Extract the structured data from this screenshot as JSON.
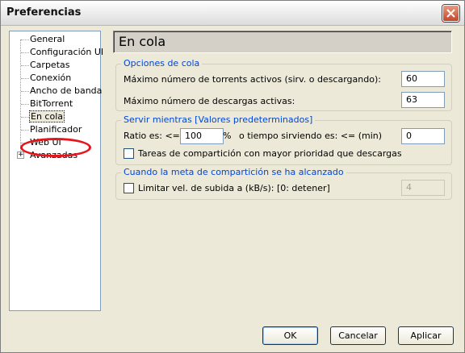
{
  "window": {
    "title": "Preferencias"
  },
  "nav": {
    "items": [
      "General",
      "Configuración UI",
      "Carpetas",
      "Conexión",
      "Ancho de banda",
      "BitTorrent",
      "En cola",
      "Planificador",
      "Web UI",
      "Avanzadas"
    ],
    "selected": "En cola",
    "expand_symbol": "+"
  },
  "page": {
    "title": "En cola"
  },
  "queue": {
    "group_label": "Opciones de cola",
    "max_active_label": "Máximo número de torrents activos (sirv. o descargando):",
    "max_active_value": "60",
    "max_downloads_label": "Máximo número de descargas activas:",
    "max_downloads_value": "63"
  },
  "seeding": {
    "group_label": "Servir mientras [Valores predeterminados]",
    "ratio_label": "Ratio es: <=",
    "ratio_value": "100",
    "percent_label": "%",
    "time_label": "o tiempo sirviendo es: <= (min)",
    "time_value": "0",
    "priority_label": "Tareas de compartición con mayor prioridad que descargas",
    "priority_checked": false
  },
  "goal": {
    "group_label": "Cuando la meta de compartición se ha alcanzado",
    "limit_label": "Limitar vel. de subida a (kB/s): [0: detener]",
    "limit_checked": false,
    "limit_value": "4"
  },
  "buttons": {
    "ok": "OK",
    "cancel": "Cancelar",
    "apply": "Aplicar"
  },
  "colors": {
    "accent": "#0046d5",
    "annotation": "#e8141b"
  },
  "icons": {
    "close": "close-icon"
  }
}
